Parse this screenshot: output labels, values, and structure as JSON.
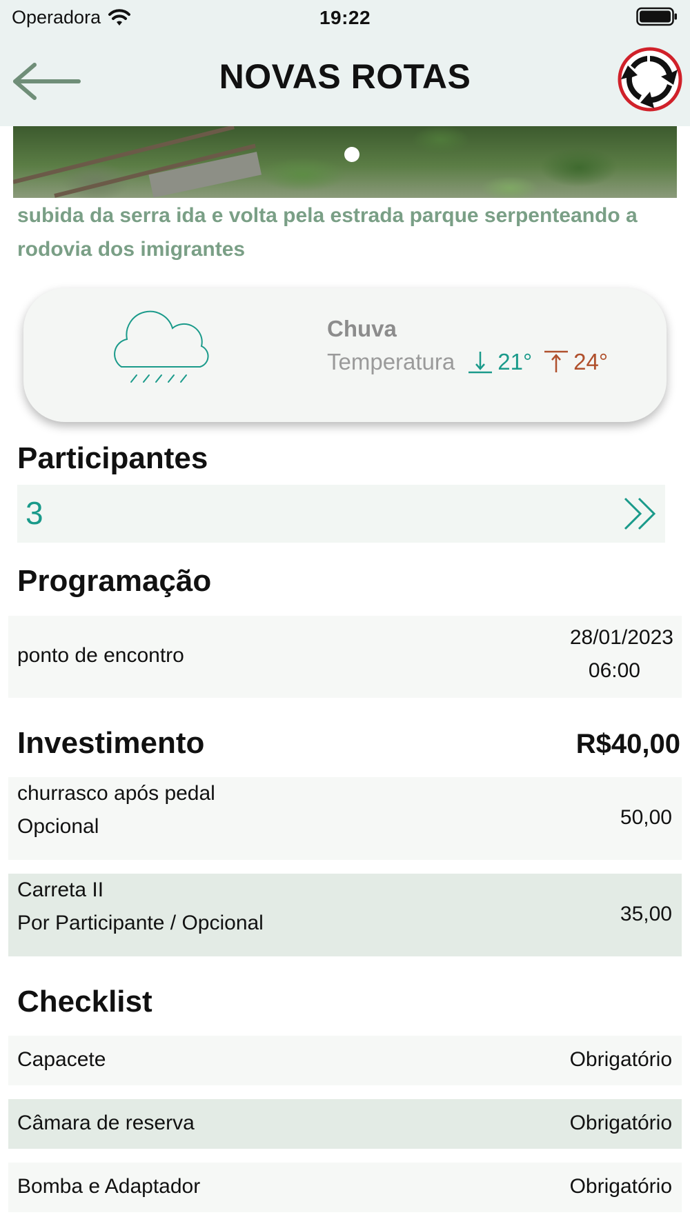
{
  "status_bar": {
    "carrier": "Operadora",
    "time": "19:22"
  },
  "nav": {
    "title": "NOVAS ROTAS",
    "back_icon": "arrow-left-icon",
    "logo_icon": "roundabout-logo-icon"
  },
  "route": {
    "description": "subida da serra ida e volta pela estrada parque serpenteando a rodovia dos imigrantes"
  },
  "weather": {
    "condition": "Chuva",
    "temperature_label": "Temperatura",
    "min": "21°",
    "max": "24°",
    "icon": "rain-cloud-icon",
    "min_color": "#1a9a8a",
    "max_color": "#b0502c"
  },
  "participants": {
    "title": "Participantes",
    "count": "3"
  },
  "schedule": {
    "title": "Programação",
    "items": [
      {
        "label": "ponto de encontro",
        "date": "28/01/2023",
        "time": "06:00"
      }
    ]
  },
  "investment": {
    "title": "Investimento",
    "total": "R$40,00",
    "items": [
      {
        "name": "churrasco após pedal",
        "note": "Opcional",
        "value": "50,00"
      },
      {
        "name": "Carreta II",
        "note": "Por Participante / Opcional",
        "value": "35,00"
      }
    ]
  },
  "checklist": {
    "title": "Checklist",
    "items": [
      {
        "name": "Capacete",
        "status": "Obrigatório"
      },
      {
        "name": "Câmara de reserva",
        "status": "Obrigatório"
      },
      {
        "name": "Bomba e Adaptador",
        "status": "Obrigatório"
      }
    ]
  },
  "colors": {
    "accent": "#1a9a8a",
    "header_bg": "#ebf2f1",
    "description": "#7a9f86"
  }
}
